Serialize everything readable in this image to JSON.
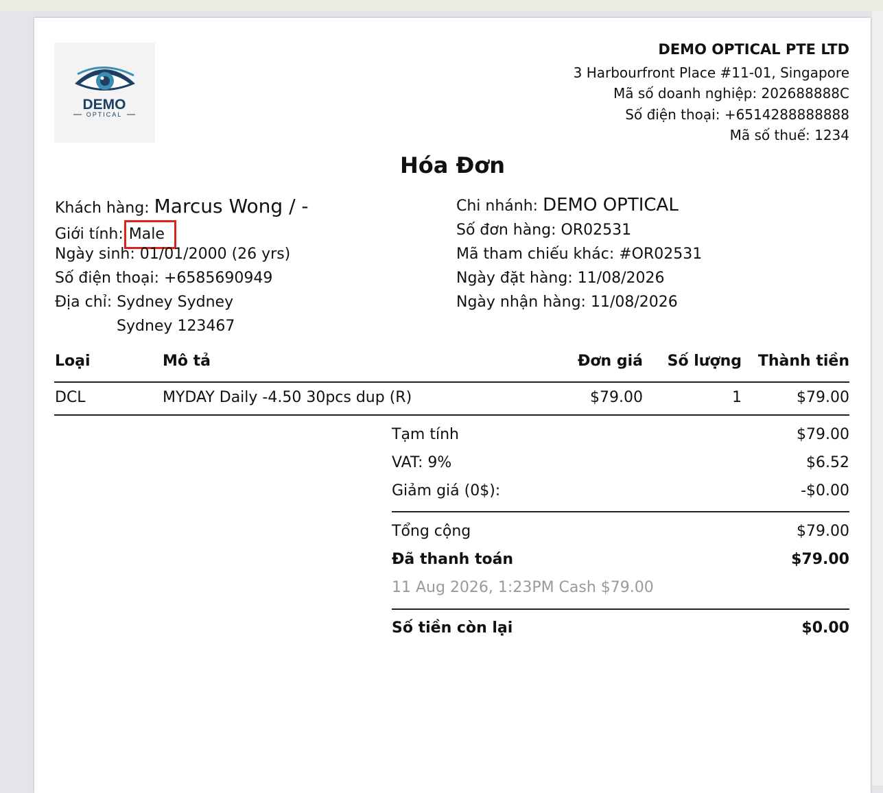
{
  "logo": {
    "line1": "DEMO",
    "line2": "OPTICAL"
  },
  "company": {
    "name": "DEMO OPTICAL PTE LTD",
    "address": "3 Harbourfront Place #11-01, Singapore",
    "reg": "Mã số doanh nghiệp: 202688888C",
    "phone": "Số điện thoại: +6514288888888",
    "tax": "Mã số thuế: 1234"
  },
  "title": "Hóa Đơn",
  "customer": {
    "name_label": "Khách hàng:",
    "name": "Marcus Wong / -",
    "gender_label": "Giới tính:",
    "gender": "Male",
    "dob": "Ngày sinh: 01/01/2000 (26 yrs)",
    "phone": "Số điện thoại: +6585690949",
    "address_label": "Địa chỉ:",
    "address_line1": "Sydney Sydney",
    "address_line2": "Sydney 123467"
  },
  "order": {
    "branch_label": "Chi nhánh:",
    "branch": "DEMO OPTICAL",
    "order_no": "Số đơn hàng: OR02531",
    "ref": "Mã tham chiếu khác: #OR02531",
    "order_date": "Ngày đặt hàng: 11/08/2026",
    "receive_date": "Ngày nhận hàng: 11/08/2026"
  },
  "table": {
    "headers": [
      "Loại",
      "Mô tả",
      "Đơn giá",
      "Số lượng",
      "Thành tiền"
    ],
    "rows": [
      [
        "DCL",
        "MYDAY Daily -4.50 30pcs dup (R)",
        "$79.00",
        "1",
        "$79.00"
      ]
    ]
  },
  "summary": {
    "subtotal_label": "Tạm tính",
    "subtotal": "$79.00",
    "vat_label": "VAT: 9%",
    "vat": "$6.52",
    "discount_label": "Giảm giá (0$):",
    "discount": "-$0.00",
    "total_label": "Tổng cộng",
    "total": "$79.00",
    "paid_label": "Đã thanh toán",
    "paid": "$79.00",
    "payment_note": "11 Aug 2026, 1:23PM Cash $79.00",
    "balance_label": "Số tiền còn lại",
    "balance": "$0.00"
  },
  "colors": {
    "highlight": "#e0201c",
    "logo_navy": "#1c3f63",
    "logo_teal": "#3b8fb4"
  }
}
